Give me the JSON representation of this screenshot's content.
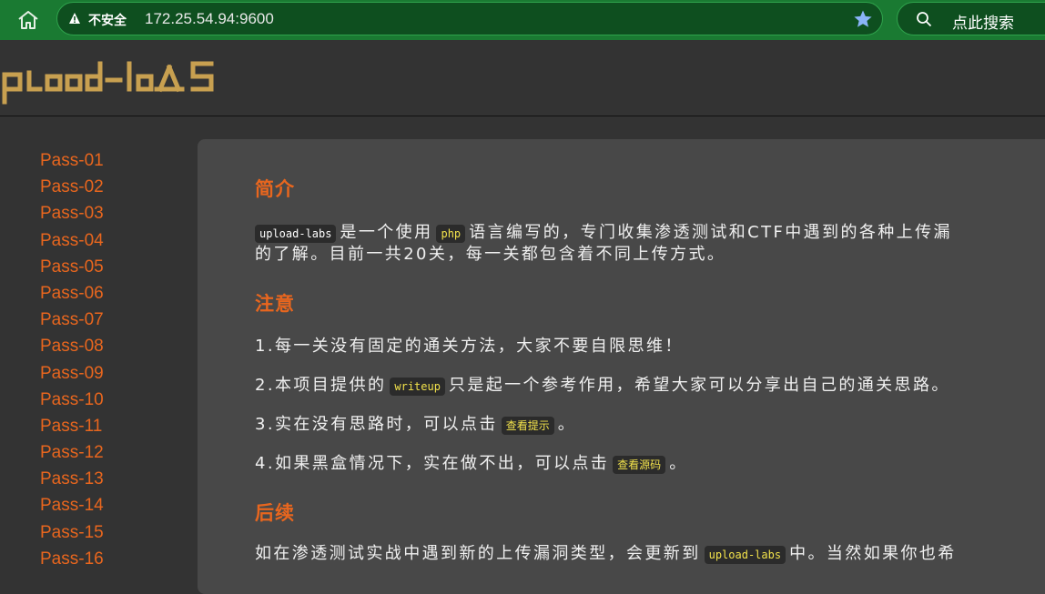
{
  "browser": {
    "insecure_label": "不安全",
    "url": "172.25.54.94:9600",
    "search_placeholder": "点此搜索"
  },
  "site": {
    "logo_text": "upload-labs"
  },
  "sidebar": {
    "items": [
      "Pass-01",
      "Pass-02",
      "Pass-03",
      "Pass-04",
      "Pass-05",
      "Pass-06",
      "Pass-07",
      "Pass-08",
      "Pass-09",
      "Pass-10",
      "Pass-11",
      "Pass-12",
      "Pass-13",
      "Pass-14",
      "Pass-15",
      "Pass-16"
    ]
  },
  "content": {
    "intro_title": "简介",
    "intro_code1": "upload-labs",
    "intro_t1": "是一个使用",
    "intro_code2": "php",
    "intro_t2": "语言编写的，专门收集渗透测试和CTF中遇到的各种上传漏",
    "intro_line2": "的了解。目前一共20关，每一关都包含着不同上传方式。",
    "notice_title": "注意",
    "n1": "1.每一关没有固定的通关方法，大家不要自限思维！",
    "n2_a": "2.本项目提供的",
    "n2_code": "writeup",
    "n2_b": "只是起一个参考作用，希望大家可以分享出自己的通关思路。",
    "n3_a": "3.实在没有思路时，可以点击",
    "n3_link": "查看提示",
    "n3_b": "。",
    "n4_a": "4.如果黑盒情况下，实在做不出，可以点击",
    "n4_link": "查看源码",
    "n4_b": "。",
    "follow_title": "后续",
    "f1_a": "如在渗透测试实战中遇到新的上传漏洞类型，会更新到",
    "f1_code": "upload-labs",
    "f1_b": "中。当然如果你也希"
  },
  "colors": {
    "accent": "#e8661e",
    "code": "#f2e24b",
    "browser_bar": "#1a7a32"
  }
}
